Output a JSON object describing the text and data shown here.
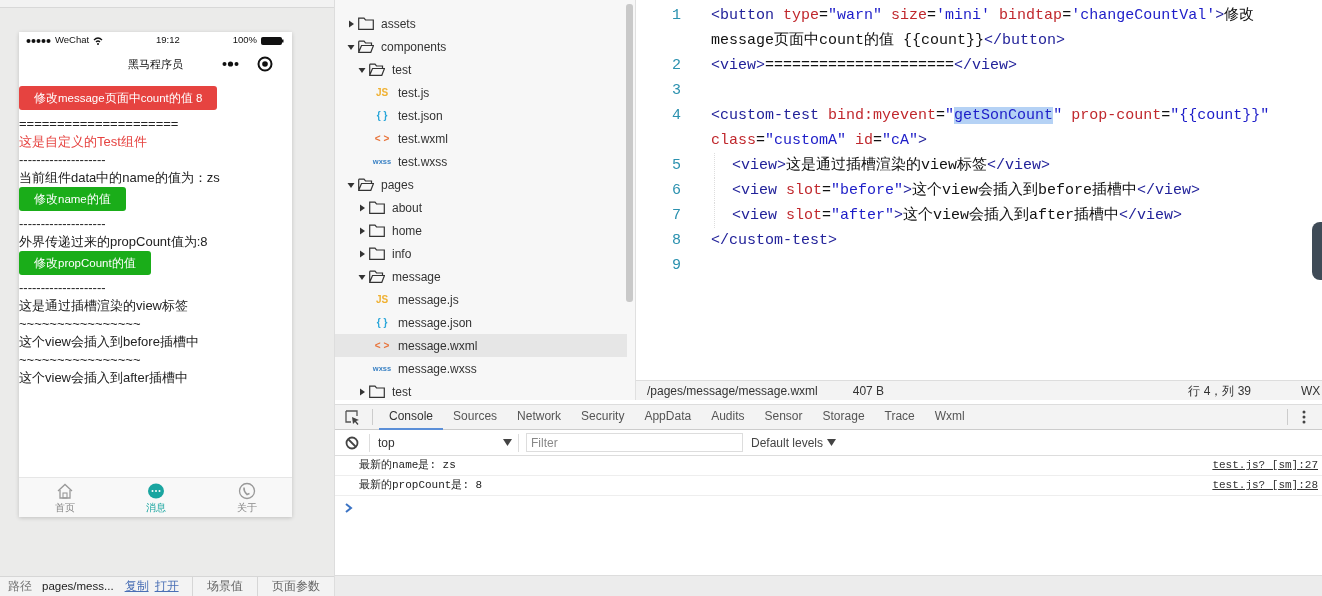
{
  "simulator": {
    "status_bar": {
      "carrier": "WeChat",
      "time": "19:12",
      "battery": "100%"
    },
    "nav_title": "黑马程序员",
    "content": [
      {
        "kind": "warn-button",
        "text": "修改message页面中count的值 8"
      },
      {
        "kind": "text",
        "text": "====================="
      },
      {
        "kind": "accent",
        "text": "这是自定义的Test组件"
      },
      {
        "kind": "text",
        "text": "--------------------"
      },
      {
        "kind": "text",
        "text": "当前组件data中的name的值为：zs"
      },
      {
        "kind": "primary-button",
        "text": "修改name的值"
      },
      {
        "kind": "text",
        "text": "--------------------"
      },
      {
        "kind": "text",
        "text": "外界传递过来的propCount值为:8"
      },
      {
        "kind": "primary-button",
        "text": "修改propCount的值"
      },
      {
        "kind": "text",
        "text": "--------------------"
      },
      {
        "kind": "text",
        "text": "这是通过插槽渲染的view标签"
      },
      {
        "kind": "text",
        "text": "~~~~~~~~~~~~~~~~"
      },
      {
        "kind": "text",
        "text": "这个view会插入到before插槽中"
      },
      {
        "kind": "text",
        "text": "~~~~~~~~~~~~~~~~"
      },
      {
        "kind": "text",
        "text": "这个view会插入到after插槽中"
      }
    ],
    "tabbar": [
      {
        "label": "首页",
        "selected": false
      },
      {
        "label": "消息",
        "selected": true
      },
      {
        "label": "关于",
        "selected": false
      }
    ]
  },
  "simulator_footer": [
    {
      "kind": "label",
      "text": "路径"
    },
    {
      "kind": "value",
      "text": "pages/mess..."
    },
    {
      "kind": "link",
      "text": "复制"
    },
    {
      "kind": "link",
      "text": "打开"
    },
    {
      "kind": "tab",
      "text": "场景值"
    },
    {
      "kind": "tab",
      "text": "页面参数"
    }
  ],
  "file_tree": [
    {
      "kind": "folder",
      "label": "assets",
      "expanded": false,
      "selected": false
    },
    {
      "kind": "folder",
      "label": "components",
      "expanded": true,
      "selected": false,
      "children": [
        {
          "kind": "folder",
          "label": "test",
          "expanded": true,
          "selected": false,
          "children": [
            {
              "kind": "js",
              "icon_text": "JS",
              "label": "test.js",
              "selected": false
            },
            {
              "kind": "json",
              "icon_text": "{ }",
              "label": "test.json",
              "selected": false
            },
            {
              "kind": "wxml",
              "icon_text": "< >",
              "label": "test.wxml",
              "selected": false
            },
            {
              "kind": "wxss",
              "icon_text": "wxss",
              "label": "test.wxss",
              "selected": false
            }
          ]
        }
      ]
    },
    {
      "kind": "folder",
      "label": "pages",
      "expanded": true,
      "selected": false,
      "children": [
        {
          "kind": "folder",
          "label": "about",
          "expanded": false,
          "selected": false
        },
        {
          "kind": "folder",
          "label": "home",
          "expanded": false,
          "selected": false
        },
        {
          "kind": "folder",
          "label": "info",
          "expanded": false,
          "selected": false
        },
        {
          "kind": "folder",
          "label": "message",
          "expanded": true,
          "selected": false,
          "children": [
            {
              "kind": "js",
              "icon_text": "JS",
              "label": "message.js",
              "selected": false
            },
            {
              "kind": "json",
              "icon_text": "{ }",
              "label": "message.json",
              "selected": false
            },
            {
              "kind": "wxml",
              "icon_text": "< >",
              "label": "message.wxml",
              "selected": true
            },
            {
              "kind": "wxss",
              "icon_text": "wxss",
              "label": "message.wxss",
              "selected": false
            }
          ]
        },
        {
          "kind": "folder",
          "label": "test",
          "expanded": false,
          "selected": false
        }
      ]
    }
  ],
  "code_lines": [
    {
      "number": "1",
      "indented": false,
      "rows": [
        {
          "tokens": [
            {
              "kind": "tag",
              "text": "<button "
            },
            {
              "kind": "attr",
              "text": "type"
            },
            {
              "kind": "punct",
              "text": "="
            },
            {
              "kind": "value",
              "text": "\"warn\" "
            },
            {
              "kind": "attr",
              "text": "size"
            },
            {
              "kind": "punct",
              "text": "="
            },
            {
              "kind": "value",
              "text": "'mini' "
            },
            {
              "kind": "attr",
              "text": "bindtap"
            },
            {
              "kind": "punct",
              "text": "="
            },
            {
              "kind": "value",
              "text": "'changeCountVal'"
            },
            {
              "kind": "tag",
              "text": ">"
            },
            {
              "kind": "text",
              "text": "修改"
            }
          ]
        },
        {
          "tokens": [
            {
              "kind": "text",
              "text": "message页面中count的值 {{count}}"
            },
            {
              "kind": "tag",
              "text": "</button>"
            }
          ]
        }
      ]
    },
    {
      "number": "2",
      "indented": false,
      "rows": [
        {
          "tokens": [
            {
              "kind": "tag",
              "text": "<view>"
            },
            {
              "kind": "text",
              "text": "====================="
            },
            {
              "kind": "tag",
              "text": "</view>"
            }
          ]
        }
      ]
    },
    {
      "number": "3"
    },
    {
      "number": "4",
      "indented": false,
      "rows": [
        {
          "tokens": [
            {
              "kind": "tag",
              "text": "<custom-test "
            },
            {
              "kind": "attr",
              "text": "bind:myevent"
            },
            {
              "kind": "punct",
              "text": "="
            },
            {
              "kind": "value",
              "text": "\""
            },
            {
              "kind": "selection",
              "text": "getSonCount"
            },
            {
              "kind": "value",
              "text": "\" "
            },
            {
              "kind": "attr",
              "text": "prop-count"
            },
            {
              "kind": "punct",
              "text": "="
            },
            {
              "kind": "value",
              "text": "\"{{count}}\""
            }
          ]
        },
        {
          "tokens": [
            {
              "kind": "attr",
              "text": "class"
            },
            {
              "kind": "punct",
              "text": "="
            },
            {
              "kind": "value",
              "text": "\"customA\" "
            },
            {
              "kind": "attr",
              "text": "id"
            },
            {
              "kind": "punct",
              "text": "="
            },
            {
              "kind": "value",
              "text": "\"cA\""
            },
            {
              "kind": "tag",
              "text": ">"
            }
          ]
        }
      ]
    },
    {
      "number": "5",
      "indented": true,
      "rows": [
        {
          "tokens": [
            {
              "kind": "tag",
              "text": "<view>"
            },
            {
              "kind": "text",
              "text": "这是通过插槽渲染的view标签"
            },
            {
              "kind": "tag",
              "text": "</view>"
            }
          ]
        }
      ]
    },
    {
      "number": "6",
      "indented": true,
      "rows": [
        {
          "tokens": [
            {
              "kind": "tag",
              "text": "<view "
            },
            {
              "kind": "attr",
              "text": "slot"
            },
            {
              "kind": "punct",
              "text": "="
            },
            {
              "kind": "value",
              "text": "\"before\""
            },
            {
              "kind": "tag",
              "text": ">"
            },
            {
              "kind": "text",
              "text": "这个view会插入到before插槽中"
            },
            {
              "kind": "tag",
              "text": "</view>"
            }
          ]
        }
      ]
    },
    {
      "number": "7",
      "indented": true,
      "rows": [
        {
          "tokens": [
            {
              "kind": "tag",
              "text": "<view "
            },
            {
              "kind": "attr",
              "text": "slot"
            },
            {
              "kind": "punct",
              "text": "="
            },
            {
              "kind": "value",
              "text": "\"after\""
            },
            {
              "kind": "tag",
              "text": ">"
            },
            {
              "kind": "text",
              "text": "这个view会插入到after插槽中"
            },
            {
              "kind": "tag",
              "text": "</view>"
            }
          ]
        }
      ]
    },
    {
      "number": "8",
      "indented": false,
      "rows": [
        {
          "tokens": [
            {
              "kind": "tag",
              "text": "</custom-test>"
            }
          ]
        }
      ]
    },
    {
      "number": "9"
    }
  ],
  "editor_status": {
    "path": "/pages/message/message.wxml",
    "size": "407 B",
    "position": "行 4，列 39",
    "language": "WX"
  },
  "devtools": {
    "tabs": [
      {
        "label": "Console",
        "selected": true
      },
      {
        "label": "Sources",
        "selected": false
      },
      {
        "label": "Network",
        "selected": false
      },
      {
        "label": "Security",
        "selected": false
      },
      {
        "label": "AppData",
        "selected": false
      },
      {
        "label": "Audits",
        "selected": false
      },
      {
        "label": "Sensor",
        "selected": false
      },
      {
        "label": "Storage",
        "selected": false
      },
      {
        "label": "Trace",
        "selected": false
      },
      {
        "label": "Wxml",
        "selected": false
      }
    ],
    "context": "top",
    "filter": {
      "placeholder": "Filter"
    },
    "levels": "Default levels",
    "messages": [
      {
        "text": "最新的name是: zs",
        "source": "test.js? [sm]:27"
      },
      {
        "text": "最新的propCount是: 8",
        "source": "test.js? [sm]:28"
      }
    ]
  }
}
